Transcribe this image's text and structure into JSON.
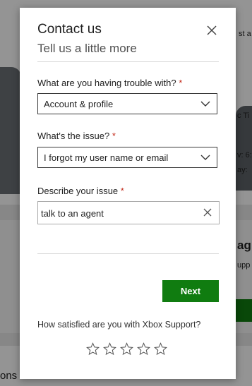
{
  "background": {
    "peek_texts": [
      "...",
      "st a",
      "c Ti",
      "v: 6:",
      "ay:",
      "ag",
      "upp",
      "ons"
    ]
  },
  "dialog": {
    "title": "Contact us",
    "subtitle": "Tell us a little more",
    "close_icon": "close-icon",
    "fields": {
      "trouble": {
        "label": "What are you having trouble with?",
        "required_mark": "*",
        "value": "Account & profile"
      },
      "issue": {
        "label": "What's the issue?",
        "required_mark": "*",
        "value": "I forgot my user name or email"
      },
      "describe": {
        "label": "Describe your issue",
        "required_mark": "*",
        "value": "talk to an agent"
      }
    },
    "next_label": "Next",
    "satisfaction_question": "How satisfied are you with Xbox Support?",
    "rating": {
      "max": 5,
      "selected": 0
    },
    "colors": {
      "accent": "#107c10",
      "required": "#c42b1c"
    }
  }
}
